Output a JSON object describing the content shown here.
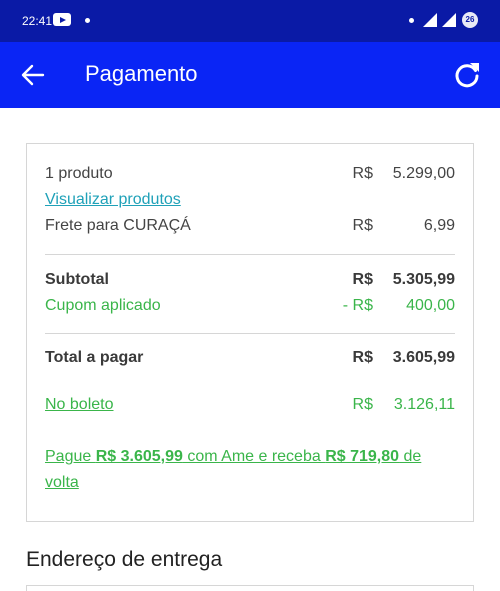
{
  "status_bar": {
    "time": "22:41",
    "battery_label": "26"
  },
  "app_bar": {
    "title": "Pagamento"
  },
  "summary": {
    "product_count": "1 produto",
    "product_currency": "R$",
    "product_value": "5.299,00",
    "view_products_link": "Visualizar produtos",
    "shipping_label": "Frete para CURAÇÁ",
    "shipping_currency": "R$",
    "shipping_value": "6,99",
    "subtotal_label": "Subtotal",
    "subtotal_currency": "R$",
    "subtotal_value": "5.305,99",
    "coupon_label": "Cupom aplicado",
    "coupon_currency": "- R$",
    "coupon_value": "400,00",
    "total_label": "Total a pagar",
    "total_currency": "R$",
    "total_value": "3.605,99",
    "boleto_label": "No boleto",
    "boleto_currency": "R$",
    "boleto_value": "3.126,11",
    "ame_prefix": "Pague ",
    "ame_amount": "R$ 3.605,99",
    "ame_middle": " com Ame e receba ",
    "ame_cashback": "R$ 719,80",
    "ame_suffix": " de volta"
  },
  "address": {
    "section_title": "Endereço de entrega"
  },
  "colors": {
    "status_bar": "#0a1aa6",
    "app_bar": "#0a25f5",
    "green": "#3ab54a",
    "link_teal": "#1fa1b8"
  }
}
